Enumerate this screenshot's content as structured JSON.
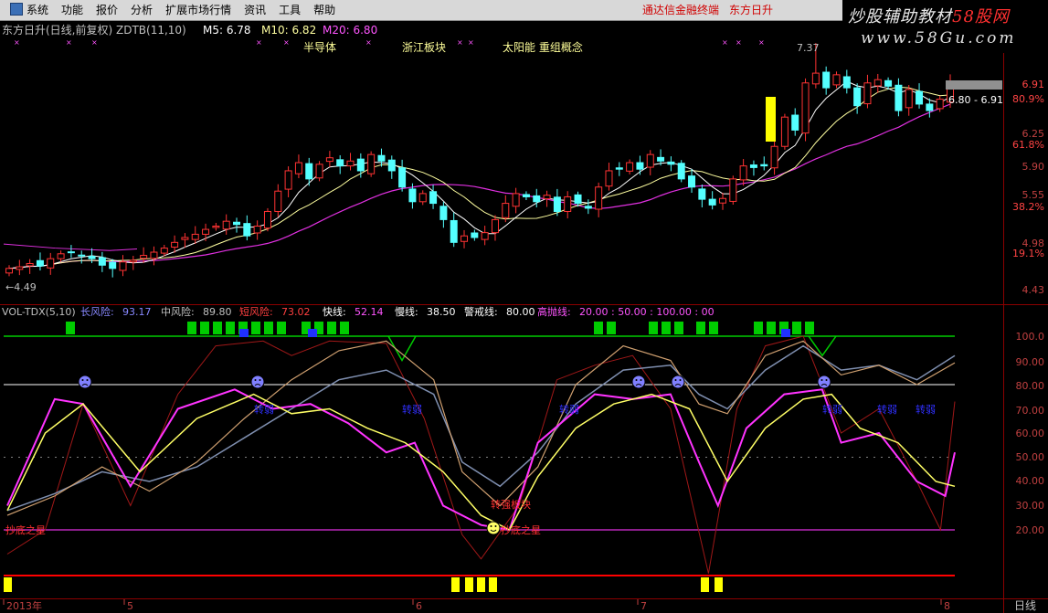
{
  "menu": {
    "items": [
      "系统",
      "功能",
      "报价",
      "分析",
      "扩展市场行情",
      "资讯",
      "工具",
      "帮助"
    ],
    "broker": "通达信金融终端",
    "stock_name": "东方日升"
  },
  "brand": {
    "line1_pre": "炒股辅助教材",
    "line1_hl": "58股网",
    "line2": "www.58Gu.com"
  },
  "price_panel": {
    "title": "东方日升(日线,前复权) ZDTB(11,10)",
    "m5": "M5: 6.78",
    "m10": "M10: 6.82",
    "m20": "M20: 6.80",
    "concepts": [
      "半导体",
      "浙江板块",
      "太阳能 重组概念"
    ],
    "high_label": "7.37",
    "low_label": "4.49",
    "range_label": "6.80 - 6.91",
    "yaxis": [
      {
        "v": "6.91",
        "c": "#ff4444"
      },
      {
        "v": "80.9%",
        "c": "#ff4444"
      },
      {
        "v": "6.25",
        "c": "#c04040"
      },
      {
        "v": "61.8%",
        "c": "#ff4444"
      },
      {
        "v": "5.90",
        "c": "#c04040"
      },
      {
        "v": "5.55",
        "c": "#c04040"
      },
      {
        "v": "38.2%",
        "c": "#ff4444"
      },
      {
        "v": "4.98",
        "c": "#c04040"
      },
      {
        "v": "19.1%",
        "c": "#ff4444"
      },
      {
        "v": "4.43",
        "c": "#c04040"
      }
    ]
  },
  "ind_panel": {
    "title": "VOL-TDX(5,10)",
    "fields": [
      {
        "label": "长风险:",
        "value": "93.17",
        "color": "#8888ff"
      },
      {
        "label": "中风险:",
        "value": "89.80",
        "color": "#c0c0c0"
      },
      {
        "label": "短风险:",
        "value": "73.02",
        "color": "#ff4040"
      },
      {
        "label": "快线:",
        "value": "52.14",
        "color": "#ff55ff"
      },
      {
        "label": "慢线:",
        "value": "38.50",
        "color": "#ffffff"
      },
      {
        "label": "警戒线:",
        "value": "80.00",
        "color": "#ffffff"
      },
      {
        "label": "高抛线:",
        "value": "20.00 : 50.00 : 100.00 : 00",
        "color": "#ff55ff"
      }
    ],
    "yaxis": [
      "100.0",
      "90.00",
      "80.00",
      "70.00",
      "60.00",
      "50.00",
      "40.00",
      "30.00",
      "20.00"
    ],
    "annotations": {
      "bottom_left": "抄底之星",
      "pivot": "转强板块",
      "bottom_mid": "抄底之星",
      "weak": "转弱"
    }
  },
  "xaxis": {
    "labels": [
      "2013年",
      "5",
      "6",
      "7",
      "8"
    ],
    "period": "日线"
  },
  "colors": {
    "up": "#ff3333",
    "down": "#54ffff",
    "ma5": "#ffffff",
    "ma10": "#ffff66",
    "ma20": "#e030e0",
    "green": "#00cc00",
    "yellow": "#ffff00",
    "red": "#ff0000"
  }
}
